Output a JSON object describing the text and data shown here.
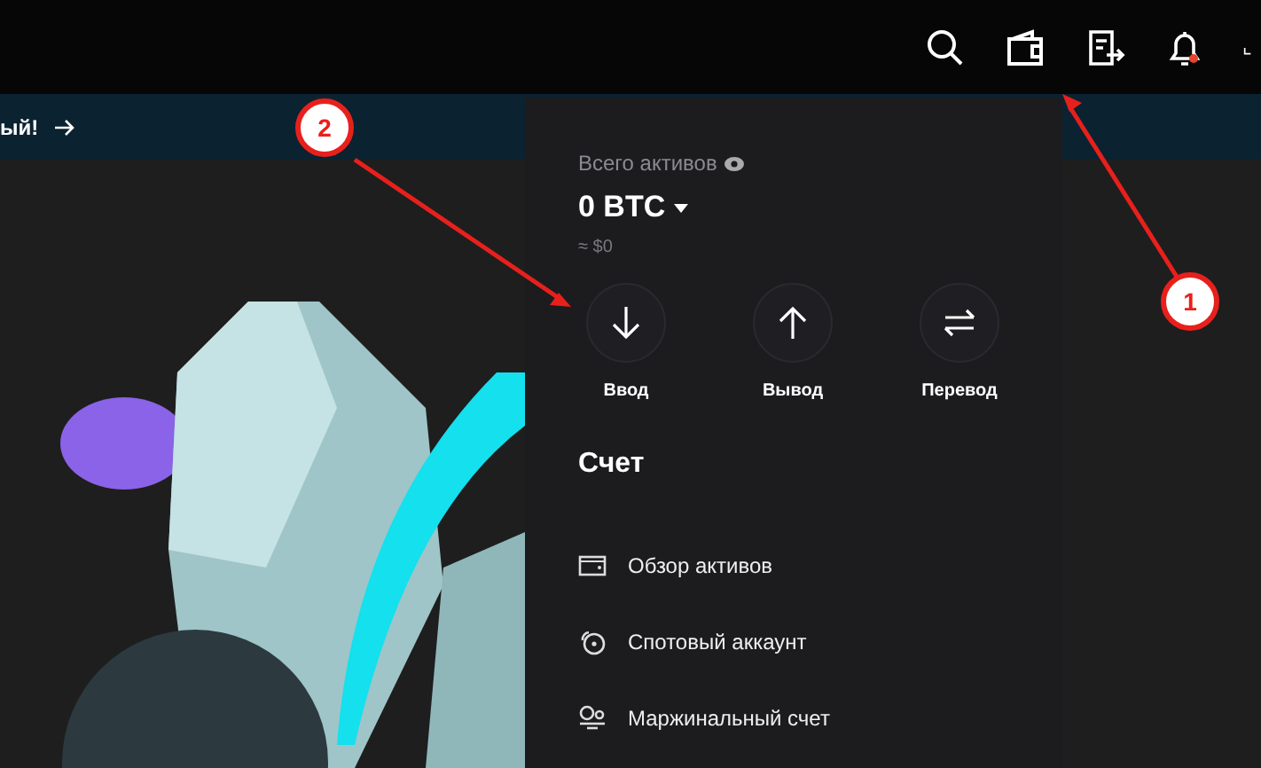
{
  "banner": {
    "text": "ый!"
  },
  "assets_panel": {
    "label": "Всего активов",
    "balance": "0 BTC",
    "approx": "≈ $0",
    "actions": [
      {
        "kind": "deposit",
        "label": "Ввод"
      },
      {
        "kind": "withdraw",
        "label": "Вывод"
      },
      {
        "kind": "transfer",
        "label": "Перевод"
      }
    ],
    "section_title": "Счет",
    "accounts": [
      {
        "kind": "overview",
        "label": "Обзор активов"
      },
      {
        "kind": "spot",
        "label": "Спотовый аккаунт"
      },
      {
        "kind": "margin",
        "label": "Маржинальный счет"
      }
    ]
  },
  "annotations": [
    {
      "number": "1"
    },
    {
      "number": "2"
    }
  ]
}
